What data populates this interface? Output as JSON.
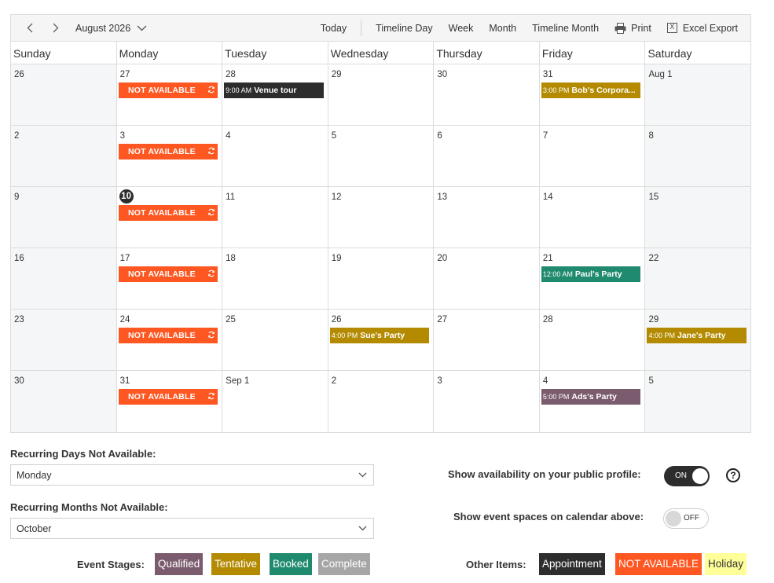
{
  "toolbar": {
    "month_label": "August 2026",
    "today": "Today",
    "timeline_day": "Timeline Day",
    "week": "Week",
    "month": "Month",
    "timeline_month": "Timeline Month",
    "print": "Print",
    "excel_export": "Excel Export"
  },
  "days_of_week": [
    "Sunday",
    "Monday",
    "Tuesday",
    "Wednesday",
    "Thursday",
    "Friday",
    "Saturday"
  ],
  "weeks": [
    [
      {
        "num": "26",
        "weekend": true
      },
      {
        "num": "27",
        "event": {
          "kind": "na",
          "label": "NOT AVAILABLE"
        }
      },
      {
        "num": "28",
        "event": {
          "kind": "appointment",
          "time": "9:00 AM",
          "title": "Venue tour"
        }
      },
      {
        "num": "29"
      },
      {
        "num": "30"
      },
      {
        "num": "31",
        "event": {
          "kind": "tentative",
          "time": "3:00 PM",
          "title": "Bob's Corpora..."
        }
      },
      {
        "num": "Aug 1",
        "weekend": true
      }
    ],
    [
      {
        "num": "2",
        "weekend": true
      },
      {
        "num": "3",
        "event": {
          "kind": "na",
          "label": "NOT AVAILABLE"
        }
      },
      {
        "num": "4"
      },
      {
        "num": "5"
      },
      {
        "num": "6"
      },
      {
        "num": "7"
      },
      {
        "num": "8",
        "weekend": true
      }
    ],
    [
      {
        "num": "9",
        "weekend": true
      },
      {
        "num": "10",
        "today": true,
        "event": {
          "kind": "na",
          "label": "NOT AVAILABLE"
        }
      },
      {
        "num": "11"
      },
      {
        "num": "12"
      },
      {
        "num": "13"
      },
      {
        "num": "14"
      },
      {
        "num": "15",
        "weekend": true
      }
    ],
    [
      {
        "num": "16",
        "weekend": true
      },
      {
        "num": "17",
        "event": {
          "kind": "na",
          "label": "NOT AVAILABLE"
        }
      },
      {
        "num": "18"
      },
      {
        "num": "19"
      },
      {
        "num": "20"
      },
      {
        "num": "21",
        "event": {
          "kind": "booked",
          "time": "12:00 AM",
          "title": "Paul's Party"
        }
      },
      {
        "num": "22",
        "weekend": true
      }
    ],
    [
      {
        "num": "23",
        "weekend": true
      },
      {
        "num": "24",
        "event": {
          "kind": "na",
          "label": "NOT AVAILABLE"
        }
      },
      {
        "num": "25"
      },
      {
        "num": "26",
        "event": {
          "kind": "tentative",
          "time": "4:00 PM",
          "title": "Sue's Party"
        }
      },
      {
        "num": "27"
      },
      {
        "num": "28"
      },
      {
        "num": "29",
        "weekend": true,
        "event": {
          "kind": "tentative",
          "time": "4:00 PM",
          "title": "Jane's Party"
        }
      }
    ],
    [
      {
        "num": "30",
        "weekend": true
      },
      {
        "num": "31",
        "event": {
          "kind": "na",
          "label": "NOT AVAILABLE"
        }
      },
      {
        "num": "Sep 1"
      },
      {
        "num": "2"
      },
      {
        "num": "3"
      },
      {
        "num": "4",
        "event": {
          "kind": "qualified",
          "time": "5:00 PM",
          "title": "Ads's Party"
        }
      },
      {
        "num": "5",
        "weekend": true
      }
    ]
  ],
  "event_colors": {
    "na": "#ff5722",
    "appointment": "#2d2d2d",
    "tentative": "#b38a00",
    "booked": "#1f8a6e",
    "qualified": "#7b5c6e"
  },
  "settings": {
    "recurring_days_label": "Recurring Days Not Available:",
    "recurring_days_value": "Monday",
    "recurring_months_label": "Recurring Months Not Available:",
    "recurring_months_value": "October",
    "show_availability_label": "Show availability on your public profile:",
    "show_availability_state": "ON",
    "show_spaces_label": "Show event spaces on calendar above:",
    "show_spaces_state": "OFF",
    "help_glyph": "?"
  },
  "legend": {
    "event_stages_label": "Event Stages:",
    "stages": [
      {
        "label": "Qualified",
        "bg": "#7b5c6e",
        "fg": "#ffffff"
      },
      {
        "label": "Tentative",
        "bg": "#b38a00",
        "fg": "#ffffff"
      },
      {
        "label": "Booked",
        "bg": "#1f8a6e",
        "fg": "#ffffff"
      },
      {
        "label": "Complete",
        "bg": "#a6a6a6",
        "fg": "#ffffff"
      }
    ],
    "other_items_label": "Other Items:",
    "items": [
      {
        "label": "Appointment",
        "bg": "#2d2d2d",
        "fg": "#ffffff"
      },
      {
        "label": "NOT AVAILABLE",
        "bg": "#ff5722",
        "fg": "#ffffff"
      },
      {
        "label": "Holiday",
        "bg": "#ffff99",
        "fg": "#333333"
      }
    ]
  }
}
